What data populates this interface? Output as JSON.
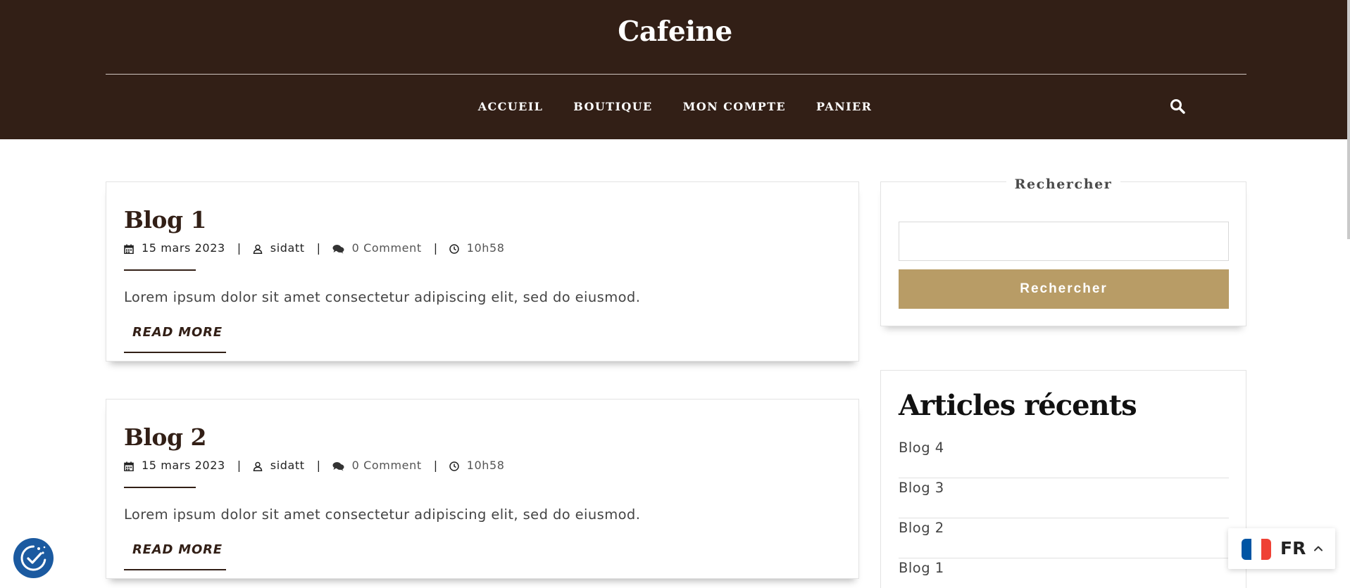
{
  "site": {
    "title": "Cafeine"
  },
  "nav": {
    "items": [
      "ACCUEIL",
      "BOUTIQUE",
      "MON COMPTE",
      "PANIER"
    ]
  },
  "icons": {
    "search": "search-icon",
    "calendar": "calendar-icon",
    "user": "user-icon",
    "comment": "comment-icon",
    "clock": "clock-icon",
    "cookie": "cookie-consent-icon",
    "chevron": "chevron-up-icon"
  },
  "posts": [
    {
      "title": "Blog 1",
      "date": "15 mars 2023",
      "author": "sidatt",
      "comments": "0 Comment",
      "time": "10h58",
      "excerpt": "Lorem ipsum dolor sit amet consectetur adipiscing elit, sed do eiusmod.",
      "more": "READ MORE"
    },
    {
      "title": "Blog 2",
      "date": "15 mars 2023",
      "author": "sidatt",
      "comments": "0 Comment",
      "time": "10h58",
      "excerpt": "Lorem ipsum dolor sit amet consectetur adipiscing elit, sed do eiusmod.",
      "more": "READ MORE"
    }
  ],
  "meta_separator": "|",
  "sidebar": {
    "search": {
      "title": "Rechercher",
      "input_value": "",
      "button_label": "Rechercher"
    },
    "recent": {
      "title": "Articles récents",
      "items": [
        "Blog 4",
        "Blog 3",
        "Blog 2",
        "Blog 1"
      ]
    }
  },
  "language": {
    "code": "FR",
    "flag_colors": [
      "#0055a4",
      "#ffffff",
      "#ef4135"
    ]
  },
  "colors": {
    "header_bg": "#321f16",
    "accent_gold": "#b89c66",
    "cookie_blue": "#1b5aa0"
  }
}
